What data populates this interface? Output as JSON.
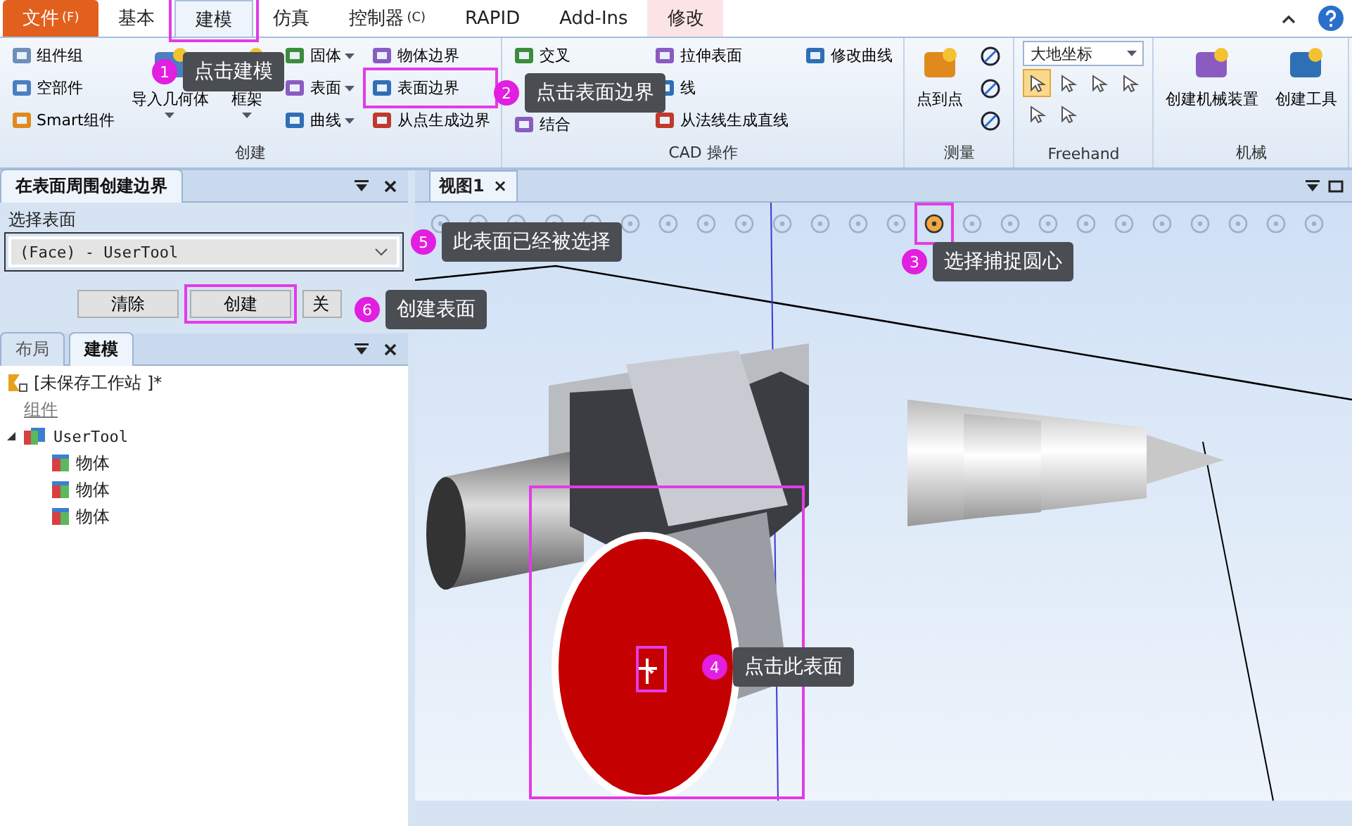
{
  "menu_tabs": [
    {
      "label": "文件",
      "suffix": "(F)",
      "kind": "file",
      "selected": false
    },
    {
      "label": "基本",
      "kind": "tab",
      "selected": false
    },
    {
      "label": "建模",
      "kind": "tab",
      "selected": true
    },
    {
      "label": "仿真",
      "kind": "tab",
      "selected": false
    },
    {
      "label": "控制器",
      "suffix": "(C)",
      "kind": "tab",
      "selected": false
    },
    {
      "label": "RAPID",
      "kind": "tab",
      "selected": false
    },
    {
      "label": "Add-Ins",
      "kind": "tab",
      "selected": false
    },
    {
      "label": "修改",
      "kind": "context",
      "selected": false
    }
  ],
  "ribbon_groups": [
    {
      "title": "创建",
      "columns": [
        [
          {
            "label": "组件组",
            "kind": "small"
          },
          {
            "label": "空部件",
            "kind": "small"
          },
          {
            "label": "Smart组件",
            "kind": "small"
          }
        ],
        [
          {
            "label": "导入几何体",
            "kind": "large",
            "dropdown": true
          }
        ],
        [
          {
            "label": "框架",
            "kind": "large",
            "dropdown": true
          }
        ],
        [
          {
            "label": "固体",
            "kind": "small",
            "dropdown": true
          },
          {
            "label": "表面",
            "kind": "small",
            "dropdown": true
          },
          {
            "label": "曲线",
            "kind": "small",
            "dropdown": true
          }
        ],
        [
          {
            "label": "物体边界",
            "kind": "small"
          },
          {
            "label": "表面边界",
            "kind": "small"
          },
          {
            "label": "从点生成边界",
            "kind": "small"
          }
        ]
      ]
    },
    {
      "title": "CAD 操作",
      "columns": [
        [
          {
            "label": "交叉",
            "kind": "small"
          },
          {
            "label": "结合",
            "kind": "small"
          }
        ],
        [
          {
            "label": "拉伸表面",
            "kind": "small"
          },
          {
            "label": "线",
            "kind": "small"
          },
          {
            "label": "从法线生成直线",
            "kind": "small"
          }
        ],
        [
          {
            "label": "修改曲线",
            "kind": "small"
          }
        ]
      ]
    },
    {
      "title": "测量",
      "columns": [
        [
          {
            "label": "点到点",
            "kind": "large"
          }
        ],
        [
          {
            "kind": "icon"
          },
          {
            "kind": "icon"
          },
          {
            "kind": "icon"
          }
        ]
      ]
    },
    {
      "title": "Freehand",
      "columns": [
        [
          {
            "label": "大地坐标",
            "kind": "select",
            "dropdown": true
          }
        ]
      ],
      "tools": [
        {
          "selected": true
        },
        {
          "selected": false
        },
        {
          "selected": false
        },
        {
          "selected": false
        },
        {
          "selected": false
        },
        {
          "selected": false
        }
      ]
    },
    {
      "title": "机械",
      "columns": [
        [
          {
            "label": "创建机械装置",
            "kind": "large"
          }
        ],
        [
          {
            "label": "创建工具",
            "kind": "large"
          }
        ]
      ]
    }
  ],
  "dialog": {
    "title": "在表面周围创建边界",
    "field_label": "选择表面",
    "field_value": "(Face) - UserTool",
    "buttons": [
      "清除",
      "创建",
      "关"
    ]
  },
  "tree_panel": {
    "tabs": [
      {
        "label": "布局",
        "selected": false
      },
      {
        "label": "建模",
        "selected": true
      }
    ],
    "station": "[未保存工作站 ]*",
    "group_link": "组件",
    "items": [
      {
        "label": "UserTool",
        "expanded": true,
        "children": [
          {
            "label": "物体"
          },
          {
            "label": "物体"
          },
          {
            "label": "物体"
          }
        ]
      }
    ]
  },
  "viewport": {
    "tab": "视图1",
    "close": "×",
    "snap_tools": [
      {
        "selected": false
      },
      {
        "selected": false
      },
      {
        "selected": false
      },
      {
        "selected": false
      },
      {
        "selected": false
      },
      {
        "selected": false
      },
      {
        "selected": false
      },
      {
        "selected": false
      },
      {
        "selected": false
      },
      {
        "selected": false
      },
      {
        "selected": false
      },
      {
        "selected": false
      },
      {
        "selected": false
      },
      {
        "selected": true
      },
      {
        "selected": false
      },
      {
        "selected": false
      },
      {
        "selected": false
      },
      {
        "selected": false
      },
      {
        "selected": false
      },
      {
        "selected": false
      },
      {
        "selected": false
      },
      {
        "selected": false
      },
      {
        "selected": false
      },
      {
        "selected": false
      }
    ]
  },
  "callouts": [
    {
      "number": "1",
      "text": "点击建模"
    },
    {
      "number": "2",
      "text": "点击表面边界"
    },
    {
      "number": "3",
      "text": "选择捕捉圆心"
    },
    {
      "number": "4",
      "text": "点击此表面"
    },
    {
      "number": "5",
      "text": "此表面已经被选择"
    },
    {
      "number": "6",
      "text": "创建表面"
    }
  ]
}
